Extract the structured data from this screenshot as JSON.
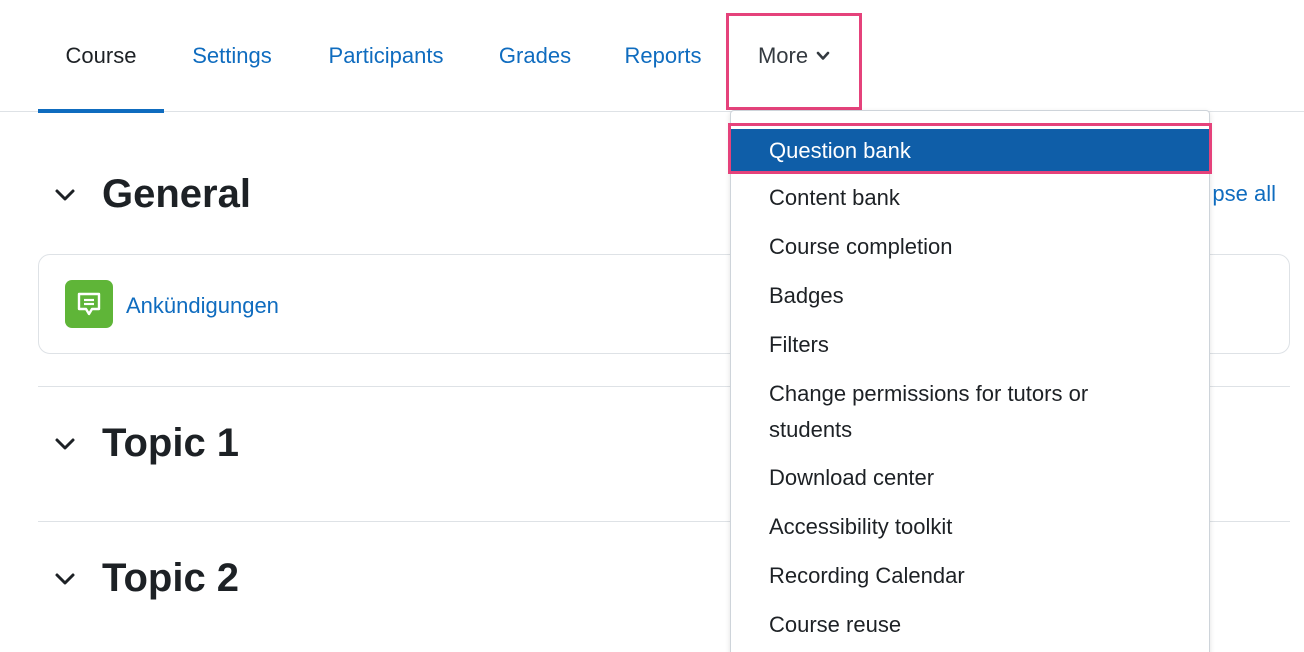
{
  "nav": {
    "tabs": [
      {
        "label": "Course",
        "active": true
      },
      {
        "label": "Settings",
        "active": false
      },
      {
        "label": "Participants",
        "active": false
      },
      {
        "label": "Grades",
        "active": false
      },
      {
        "label": "Reports",
        "active": false
      },
      {
        "label": "More",
        "active": false
      }
    ],
    "more_icon": "chevron-down-icon"
  },
  "course": {
    "collapse_all_label": "pse all",
    "sections": [
      {
        "title": "General",
        "icon": "chevron-down-icon"
      },
      {
        "title": "Topic 1",
        "icon": "chevron-down-icon"
      },
      {
        "title": "Topic 2",
        "icon": "chevron-down-icon"
      }
    ],
    "activity": {
      "label": "Ankündigungen",
      "icon": "forum-icon",
      "icon_color": "#5fb538"
    }
  },
  "dropdown": {
    "items": [
      {
        "label": "Question bank",
        "active": true
      },
      {
        "label": "Content bank"
      },
      {
        "label": "Course completion"
      },
      {
        "label": "Badges"
      },
      {
        "label": "Filters"
      },
      {
        "label": "Change permissions for tutors or students"
      },
      {
        "label": "Download center"
      },
      {
        "label": "Accessibility toolkit"
      },
      {
        "label": "Recording Calendar"
      },
      {
        "label": "Course reuse"
      }
    ]
  },
  "colors": {
    "link": "#0f6cbf",
    "active_item_bg": "#0f5ea8",
    "highlight_border": "#e5427b",
    "text": "#1d2125"
  }
}
